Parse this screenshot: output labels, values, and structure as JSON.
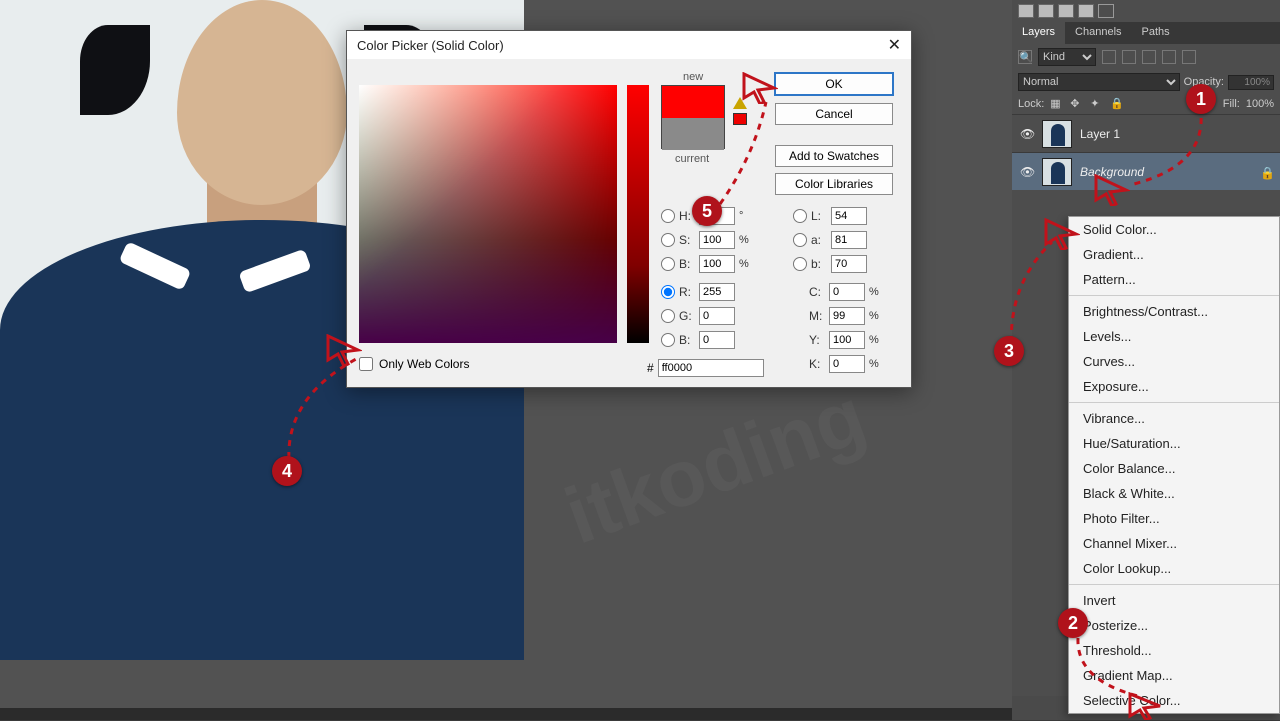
{
  "canvas": {
    "watermark": "itkoding"
  },
  "panel": {
    "tabs": {
      "layers": "Layers",
      "channels": "Channels",
      "paths": "Paths"
    },
    "filter_label": "Kind",
    "blend_mode": "Normal",
    "opacity_label": "Opacity:",
    "opacity_value": "100%",
    "lock_label": "Lock:",
    "fill_label": "Fill:",
    "fill_value": "100%",
    "layers": [
      {
        "name": "Layer 1",
        "locked": false
      },
      {
        "name": "Background",
        "locked": true
      }
    ]
  },
  "adj_menu": {
    "items_top": [
      "Solid Color...",
      "Gradient...",
      "Pattern..."
    ],
    "items_adjust": [
      "Brightness/Contrast...",
      "Levels...",
      "Curves...",
      "Exposure..."
    ],
    "items_color": [
      "Vibrance...",
      "Hue/Saturation...",
      "Color Balance...",
      "Black & White...",
      "Photo Filter...",
      "Channel Mixer...",
      "Color Lookup..."
    ],
    "items_misc": [
      "Invert",
      "Posterize...",
      "Threshold...",
      "Gradient Map...",
      "Selective Color..."
    ]
  },
  "dialog": {
    "title": "Color Picker (Solid Color)",
    "new_label": "new",
    "current_label": "current",
    "buttons": {
      "ok": "OK",
      "cancel": "Cancel",
      "add_swatch": "Add to Swatches",
      "libraries": "Color Libraries"
    },
    "h_label": "H:",
    "h_value": "",
    "h_unit": "°",
    "s_label": "S:",
    "s_value": "100",
    "s_unit": "%",
    "bHSB_label": "B:",
    "bHSB_value": "100",
    "bHSB_unit": "%",
    "r_label": "R:",
    "r_value": "255",
    "g_label": "G:",
    "g_value": "0",
    "bRGB_label": "B:",
    "bRGB_value": "0",
    "L_label": "L:",
    "L_value": "54",
    "a_label": "a:",
    "a_value": "81",
    "bLab_label": "b:",
    "bLab_value": "70",
    "C_label": "C:",
    "C_value": "0",
    "M_label": "M:",
    "M_value": "99",
    "Y_label": "Y:",
    "Y_value": "100",
    "K_label": "K:",
    "K_value": "0",
    "cmyk_unit": "%",
    "hex_prefix": "#",
    "hex_value": "ff0000",
    "web_only": "Only Web Colors"
  },
  "annotations": {
    "b1": "1",
    "b2": "2",
    "b3": "3",
    "b4": "4",
    "b5": "5"
  }
}
